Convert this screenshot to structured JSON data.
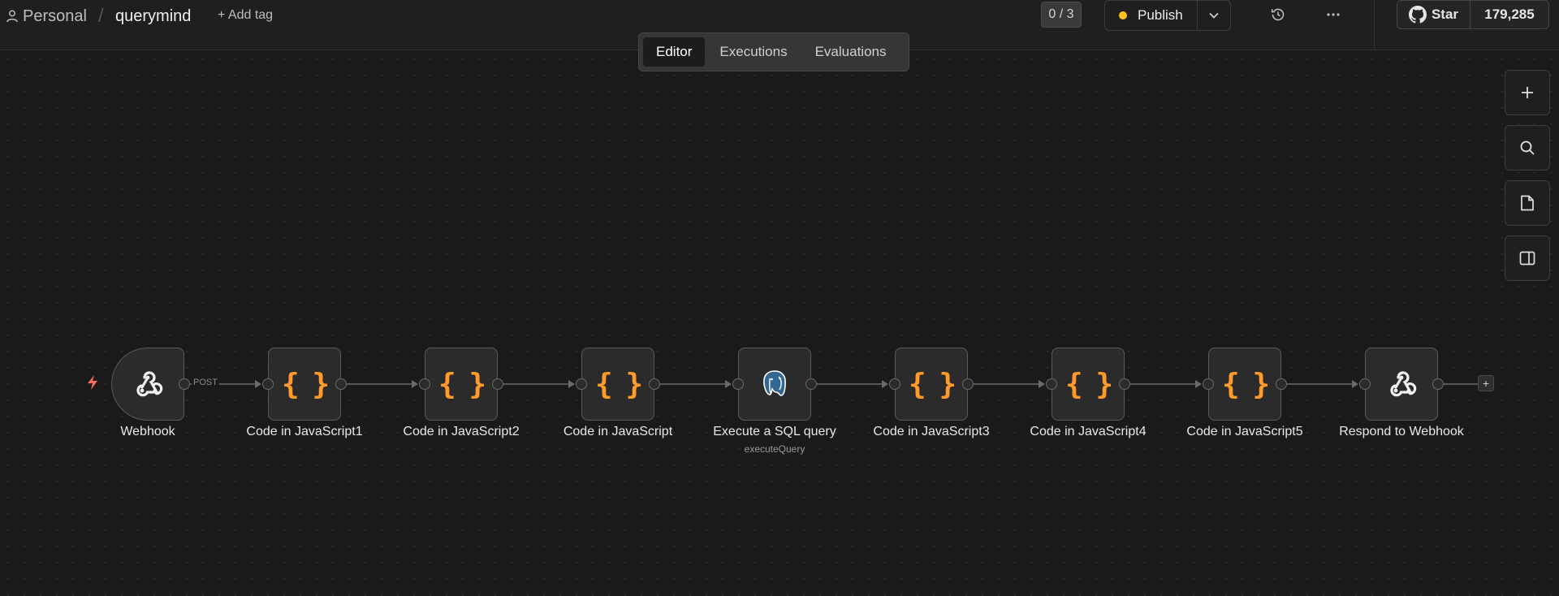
{
  "header": {
    "project": "Personal",
    "separator": "/",
    "workflow_name": "querymind",
    "add_tag": "+ Add tag",
    "counter": "0 / 3",
    "publish_label": "Publish",
    "publish_status_color": "#ffc21a",
    "github_star": "Star",
    "github_count": "179,285"
  },
  "tabs": [
    {
      "label": "Editor",
      "active": true
    },
    {
      "label": "Executions",
      "active": false
    },
    {
      "label": "Evaluations",
      "active": false
    }
  ],
  "canvas_controls": [
    "zoom-in-icon",
    "zoom-to-fit-icon",
    "sticky-note-icon",
    "toggle-panel-icon"
  ],
  "nodes": [
    {
      "label": "Webhook",
      "icon": "webhook-icon",
      "trigger": true
    },
    {
      "label": "Code in JavaScript1",
      "icon": "code-icon"
    },
    {
      "label": "Code in JavaScript2",
      "icon": "code-icon"
    },
    {
      "label": "Code in JavaScript",
      "icon": "code-icon"
    },
    {
      "label": "Execute a SQL query",
      "icon": "postgres-icon",
      "subtitle": "executeQuery"
    },
    {
      "label": "Code in JavaScript3",
      "icon": "code-icon"
    },
    {
      "label": "Code in JavaScript4",
      "icon": "code-icon"
    },
    {
      "label": "Code in JavaScript5",
      "icon": "code-icon"
    },
    {
      "label": "Respond to Webhook",
      "icon": "webhook-icon"
    }
  ],
  "connections": {
    "first_label": "POST",
    "add_node": "+"
  },
  "colors": {
    "background": "#1a1a1a",
    "code_icon": "#ff9a2b",
    "trigger_bolt": "#ff6d5a",
    "connection": "#6a6a6a"
  }
}
